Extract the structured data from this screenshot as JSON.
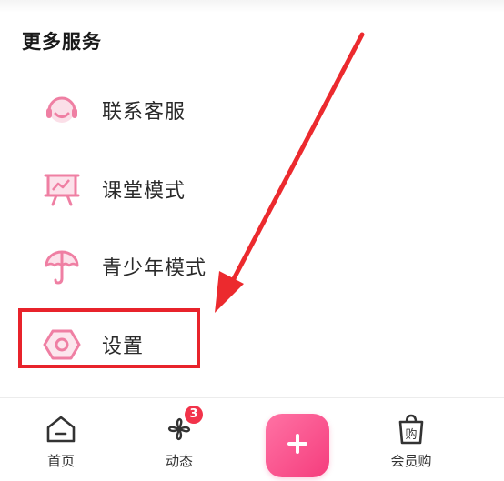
{
  "section": {
    "title": "更多服务"
  },
  "menu": {
    "items": [
      {
        "label": "联系客服",
        "icon": "headset-icon"
      },
      {
        "label": "课堂模式",
        "icon": "presentation-board-icon"
      },
      {
        "label": "青少年模式",
        "icon": "umbrella-icon"
      },
      {
        "label": "设置",
        "icon": "hexagon-settings-icon"
      }
    ]
  },
  "tabbar": {
    "home_label": "首页",
    "feed_label": "动态",
    "feed_badge": "3",
    "vip_label": "会员购",
    "vip_bag_text": "购"
  },
  "colors": {
    "accent_pink": "#f05a8c",
    "icon_pink": "#ef7fa3",
    "highlight_red": "#e8232b",
    "badge_red": "#f2334a"
  }
}
